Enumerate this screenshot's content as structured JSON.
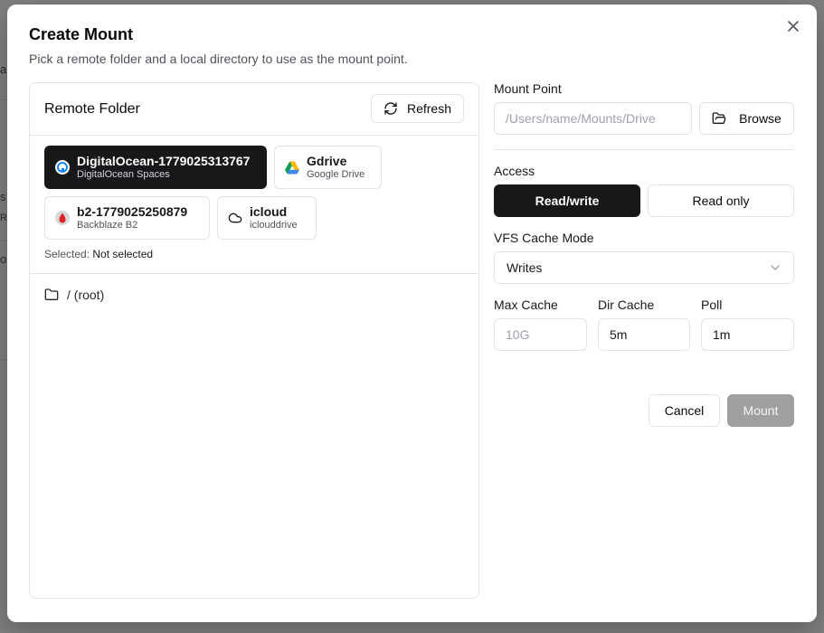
{
  "background": {
    "fragments": [
      "a",
      "s",
      "R",
      "o"
    ]
  },
  "dialog": {
    "title": "Create Mount",
    "description": "Pick a remote folder and a local directory to use as the mount point."
  },
  "remote_folder": {
    "title": "Remote Folder",
    "refresh_label": "Refresh",
    "remotes": [
      {
        "name": "DigitalOcean-1779025313767",
        "type": "DigitalOcean Spaces",
        "icon": "digitalocean-icon",
        "active": true
      },
      {
        "name": "Gdrive",
        "type": "Google Drive",
        "icon": "google-drive-icon",
        "active": false
      },
      {
        "name": "b2-1779025250879",
        "type": "Backblaze B2",
        "icon": "backblaze-icon",
        "active": false
      },
      {
        "name": "icloud",
        "type": "iclouddrive",
        "icon": "cloud-icon",
        "active": false
      }
    ],
    "selected_label": "Selected:",
    "selected_value": "Not selected",
    "root_label": "/ (root)"
  },
  "mount_point": {
    "label": "Mount Point",
    "placeholder": "/Users/name/Mounts/Drive",
    "browse_label": "Browse"
  },
  "access": {
    "label": "Access",
    "options": [
      "Read/write",
      "Read only"
    ],
    "selected": "Read/write"
  },
  "vfs_cache": {
    "label": "VFS Cache Mode",
    "value": "Writes"
  },
  "cache": {
    "max_cache_label": "Max Cache",
    "max_cache_placeholder": "10G",
    "dir_cache_label": "Dir Cache",
    "dir_cache_value": "5m",
    "poll_label": "Poll",
    "poll_value": "1m"
  },
  "actions": {
    "cancel_label": "Cancel",
    "mount_label": "Mount"
  },
  "colors": {
    "primary": "#18181b",
    "border": "#e4e4e7",
    "muted_text": "#52525b",
    "disabled_button": "#9f9f9f"
  }
}
